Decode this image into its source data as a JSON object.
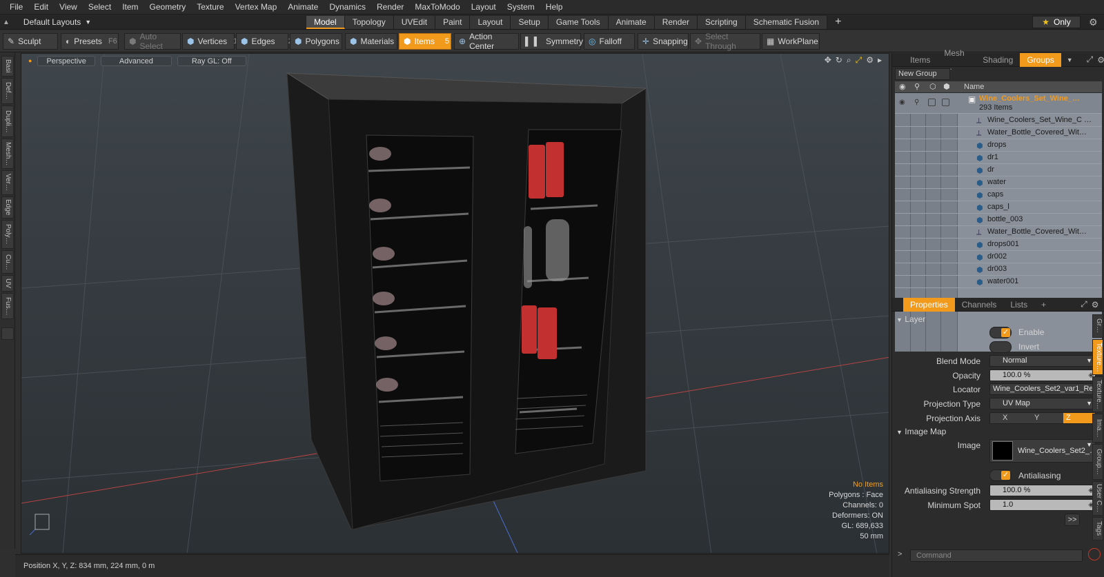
{
  "menubar": {
    "items": [
      "File",
      "Edit",
      "View",
      "Select",
      "Item",
      "Geometry",
      "Texture",
      "Vertex Map",
      "Animate",
      "Dynamics",
      "Render",
      "MaxToModo",
      "Layout",
      "System",
      "Help"
    ]
  },
  "layout": {
    "selector": "Default Layouts",
    "tabs": [
      "Model",
      "Topology",
      "UVEdit",
      "Paint",
      "Layout",
      "Setup",
      "Game Tools",
      "Animate",
      "Render",
      "Scripting",
      "Schematic Fusion"
    ],
    "active_tab": "Model",
    "only_label": "Only"
  },
  "toolbar": {
    "sculpt": "Sculpt",
    "presets": "Presets",
    "presets_key": "F6",
    "auto_select": "Auto Select",
    "vertices": "Vertices",
    "vertices_key": "1",
    "edges": "Edges",
    "edges_key": "2",
    "polygons": "Polygons",
    "materials": "Materials",
    "items": "Items",
    "items_key": "5",
    "action_center": "Action Center",
    "symmetry": "Symmetry",
    "falloff": "Falloff",
    "snapping": "Snapping",
    "select_through": "Select Through",
    "workplane": "WorkPlane"
  },
  "left_tabs": [
    "Basi",
    "Def…",
    "Dupli…",
    "Mesh…",
    "Ver…",
    "Edge",
    "Poly…",
    "Cu…",
    "UV",
    "Fus…"
  ],
  "viewport": {
    "view": "Perspective",
    "shading": "Advanced",
    "raygl": "Ray GL: Off",
    "stats": {
      "no_items": "No Items",
      "polygons": "Polygons : Face",
      "channels": "Channels: 0",
      "deformers": "Deformers: ON",
      "gl": "GL: 689,633",
      "focal": "50 mm"
    }
  },
  "status": {
    "position": "Position X, Y, Z:  834 mm, 224 mm, 0 m"
  },
  "outliner": {
    "tabs": [
      "Items",
      "Mesh …",
      "Shading",
      "Groups"
    ],
    "active_tab": "Groups",
    "new_group": "New Group",
    "col_name": "Name",
    "group_name": "Wine_Coolers_Set_Wine_…",
    "group_count": "293 Items",
    "rows": [
      {
        "name": "Wine_Coolers_Set_Wine_C …",
        "kind": "locator"
      },
      {
        "name": "Water_Bottle_Covered_Wit…",
        "kind": "locator"
      },
      {
        "name": "drops",
        "kind": "mesh"
      },
      {
        "name": "dr1",
        "kind": "mesh"
      },
      {
        "name": "dr",
        "kind": "mesh"
      },
      {
        "name": "water",
        "kind": "mesh"
      },
      {
        "name": "caps",
        "kind": "mesh"
      },
      {
        "name": "caps_l",
        "kind": "mesh"
      },
      {
        "name": "bottle_003",
        "kind": "mesh"
      },
      {
        "name": "Water_Bottle_Covered_Wit…",
        "kind": "locator"
      },
      {
        "name": "drops001",
        "kind": "mesh"
      },
      {
        "name": "dr002",
        "kind": "mesh"
      },
      {
        "name": "dr003",
        "kind": "mesh"
      },
      {
        "name": "water001",
        "kind": "mesh"
      }
    ]
  },
  "properties": {
    "tabs": [
      "Properties",
      "Channels",
      "Lists",
      "+"
    ],
    "active_tab": "Properties",
    "layer_section": "Layer",
    "enable": "Enable",
    "invert": "Invert",
    "blend_mode_label": "Blend Mode",
    "blend_mode": "Normal",
    "opacity_label": "Opacity",
    "opacity": "100.0 %",
    "locator_label": "Locator",
    "locator": "Wine_Coolers_Set2_var1_Re…",
    "projection_type_label": "Projection Type",
    "projection_type": "UV Map",
    "projection_axis_label": "Projection Axis",
    "axis_x": "X",
    "axis_y": "Y",
    "axis_z": "Z",
    "image_map_section": "Image Map",
    "image_label": "Image",
    "image": "Wine_Coolers_Set2_…",
    "antialiasing": "Antialiasing",
    "aa_strength_label": "Antialiasing Strength",
    "aa_strength": "100.0 %",
    "min_spot_label": "Minimum Spot",
    "min_spot": "1.0",
    "more": ">>",
    "side_tabs": [
      "Gr…",
      "Texture…",
      "Texture…",
      "Ima…",
      "Group…",
      "User C…",
      "Tags"
    ]
  },
  "command": {
    "placeholder": "Command"
  },
  "colors": {
    "accent": "#f29a1c",
    "list_bg": "#8a9099",
    "group_text": "#f29a1c"
  }
}
